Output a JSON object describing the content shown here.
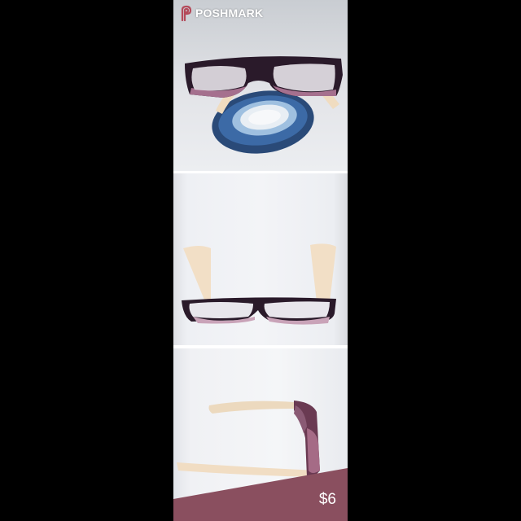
{
  "brand": {
    "name": "POSHMARK",
    "logo_icon": "poshmark-logo-icon"
  },
  "listing": {
    "price": "$6",
    "photos": [
      {
        "name": "glasses-front-with-agate"
      },
      {
        "name": "glasses-folded-front"
      },
      {
        "name": "glasses-side-view"
      }
    ]
  },
  "colors": {
    "background": "#000000",
    "price_band": "#8a4f5f",
    "frame_dark": "#2a1a2a",
    "temple": "#f0dcc0"
  }
}
